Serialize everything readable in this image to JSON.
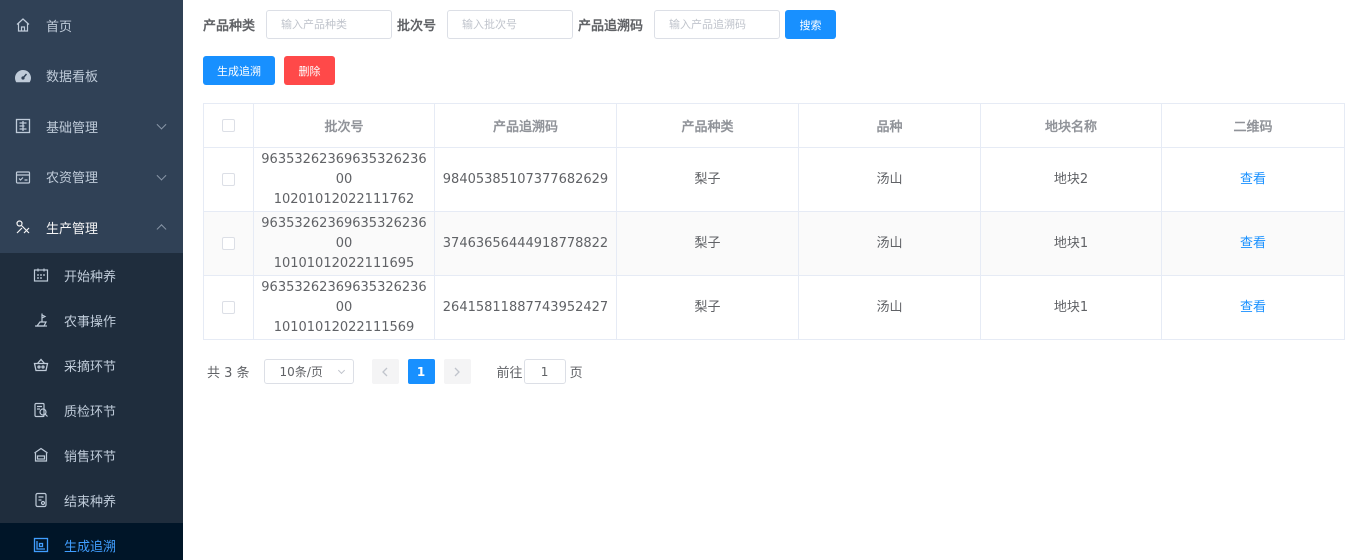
{
  "sidebar": {
    "items": [
      {
        "label": "首页",
        "icon": "home-icon"
      },
      {
        "label": "数据看板",
        "icon": "dashboard-icon"
      },
      {
        "label": "基础管理",
        "icon": "basic-manage-icon"
      },
      {
        "label": "农资管理",
        "icon": "farm-supply-icon"
      },
      {
        "label": "生产管理",
        "icon": "production-icon"
      }
    ],
    "sub_items": [
      {
        "label": "开始种养",
        "icon": "calendar-icon"
      },
      {
        "label": "农事操作",
        "icon": "farming-icon"
      },
      {
        "label": "采摘环节",
        "icon": "basket-icon"
      },
      {
        "label": "质检环节",
        "icon": "inspection-icon"
      },
      {
        "label": "销售环节",
        "icon": "store-icon"
      },
      {
        "label": "结束种养",
        "icon": "finish-icon"
      },
      {
        "label": "生成追溯",
        "icon": "trace-icon"
      }
    ],
    "active_color": "#409eff",
    "bg_color": "#304156"
  },
  "search": {
    "product_type_label": "产品种类",
    "product_type_placeholder": "输入产品种类",
    "batch_label": "批次号",
    "batch_placeholder": "输入批次号",
    "trace_code_label": "产品追溯码",
    "trace_code_placeholder": "输入产品追溯码",
    "search_button": "搜索"
  },
  "actions": {
    "generate_label": "生成追溯",
    "delete_label": "删除"
  },
  "table": {
    "headers": [
      "批次号",
      "产品追溯码",
      "产品种类",
      "品种",
      "地块名称",
      "二维码"
    ],
    "rows": [
      {
        "batch_line1": "96353262369635326236 00",
        "batch_line2": "10201012022111762",
        "trace_code": "98405385107377682629",
        "product_type": "梨子",
        "variety": "汤山",
        "plot": "地块2",
        "qr": "查看"
      },
      {
        "batch_line1": "96353262369635326236 00",
        "batch_line2": "10101012022111695",
        "trace_code": "37463656444918778822",
        "product_type": "梨子",
        "variety": "汤山",
        "plot": "地块1",
        "qr": "查看"
      },
      {
        "batch_line1": "96353262369635326236 00",
        "batch_line2": "10101012022111569",
        "trace_code": "26415811887743952427",
        "product_type": "梨子",
        "variety": "汤山",
        "plot": "地块1",
        "qr": "查看"
      }
    ]
  },
  "pagination": {
    "total": "共 3 条",
    "page_size": "10条/页",
    "current_page": "1",
    "goto_label": "前往",
    "goto_value": "1",
    "page_suffix": "页"
  }
}
